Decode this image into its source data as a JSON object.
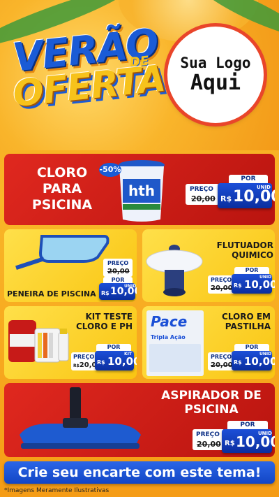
{
  "header": {
    "title_line1": "VERÃO",
    "title_de": "DE",
    "title_line2": "OFERTAS",
    "logo_line1": "Sua Logo",
    "logo_line2": "Aqui"
  },
  "labels": {
    "preco": "PREÇO",
    "por": "POR",
    "currency": "R$",
    "unit": "UNID",
    "kit": "KIT"
  },
  "products": [
    {
      "name_lines": [
        "CLORO",
        "PARA",
        "PSICINA"
      ],
      "old_price": "20,00",
      "price": "10,00",
      "unit": "UNID",
      "badge": "-50%",
      "brand": "hth"
    },
    {
      "name_lines": [
        "PENEIRA DE PISCINA"
      ],
      "old_price": "20,00",
      "price": "10,00",
      "unit": "UNID"
    },
    {
      "name_lines": [
        "FLUTUADOR",
        "QUIMICO"
      ],
      "old_price": "20,00",
      "price": "10,00",
      "unit": "UNID"
    },
    {
      "name_lines": [
        "KIT TESTE",
        "CLORO E PH"
      ],
      "old_price": "20,00",
      "price": "10,00",
      "unit": "KIT"
    },
    {
      "name_lines": [
        "CLORO EM",
        "PASTILHA"
      ],
      "old_price": "20,00",
      "price": "10,00",
      "unit": "UNID",
      "brand": "Pace",
      "sub": "Tripla Ação"
    },
    {
      "name_lines": [
        "ASPIRADOR DE",
        "PSICINA"
      ],
      "old_price": "20,00",
      "price": "10,00",
      "unit": "UNID"
    }
  ],
  "footer": {
    "cta": "Crie seu encarte com este tema!",
    "disclaimer": "*Imagens Meramente Ilustrativas"
  },
  "colors": {
    "red": "#d8231b",
    "yellow": "#fcd22c",
    "blue": "#1a4fd6",
    "orange": "#f7a41a"
  }
}
